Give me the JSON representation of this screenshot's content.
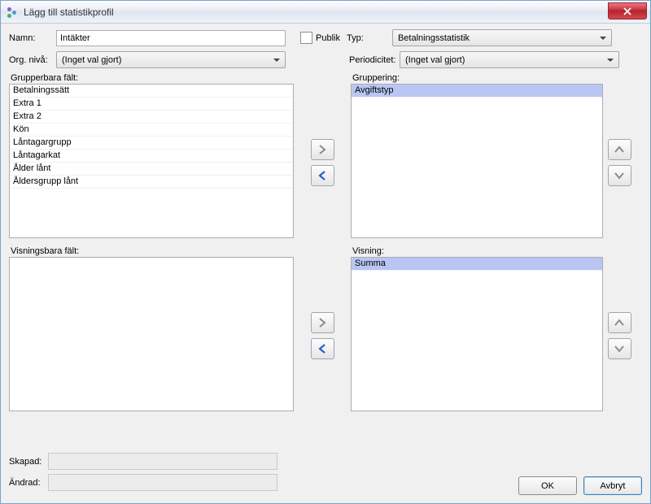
{
  "window_title": "Lägg till statistikprofil",
  "labels": {
    "name": "Namn:",
    "public": "Publik",
    "type": "Typ:",
    "org_level": "Org. nivå:",
    "periodicity": "Periodicitet:",
    "groupable_fields": "Grupperbara fält:",
    "grouping": "Gruppering:",
    "visible_fields": "Visningsbara fält:",
    "display": "Visning:",
    "created": "Skapad:",
    "modified": "Ändrad:"
  },
  "form": {
    "name_value": "Intäkter",
    "public_checked": false,
    "type_value": "Betalningsstatistik",
    "org_level_value": "(Inget val gjort)",
    "periodicity_value": "(Inget val gjort)",
    "created_value": "",
    "modified_value": ""
  },
  "groupable_fields": [
    "Betalningssätt",
    "Extra 1",
    "Extra 2",
    "Kön",
    "Låntagargrupp",
    "Låntagarkat",
    "Ålder lånt",
    "Åldersgrupp lånt"
  ],
  "grouping_items": [
    "Avgiftstyp"
  ],
  "visible_fields": [],
  "display_items": [
    "Summa"
  ],
  "buttons": {
    "ok": "OK",
    "cancel": "Avbryt"
  }
}
